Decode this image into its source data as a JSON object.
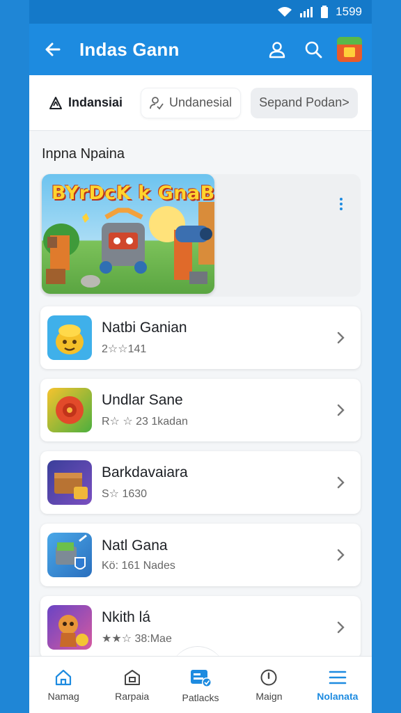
{
  "status_bar": {
    "time": "1599"
  },
  "app_bar": {
    "title": "Indas Gann"
  },
  "tabs": [
    {
      "label": "Indansiai"
    },
    {
      "label": "Undanesial"
    },
    {
      "label": "Sepand Podan>"
    }
  ],
  "section": {
    "title": "Inpna Npaina"
  },
  "featured": {
    "banner_title": "BYrDcK k GnaBi"
  },
  "games": [
    {
      "name": "Natbi Ganian",
      "meta": "2☆☆141"
    },
    {
      "name": "Undlar Sane",
      "meta": "R☆ ☆ 23 1kadan"
    },
    {
      "name": "Barkdavaiara",
      "meta": "S☆ 1630"
    },
    {
      "name": "Natl Gana",
      "meta": "Kö: 161 Nades"
    },
    {
      "name": "Nkith lá",
      "meta": "★★☆ 38:Mae"
    }
  ],
  "bottom_nav": [
    {
      "label": "Namag"
    },
    {
      "label": "Rarpaia"
    },
    {
      "label": "Patlacks"
    },
    {
      "label": "Maign"
    },
    {
      "label": "Nolanata"
    }
  ],
  "colors": {
    "primary": "#1d8be0",
    "statusbar": "#1479c9",
    "background": "#f4f6f8"
  }
}
